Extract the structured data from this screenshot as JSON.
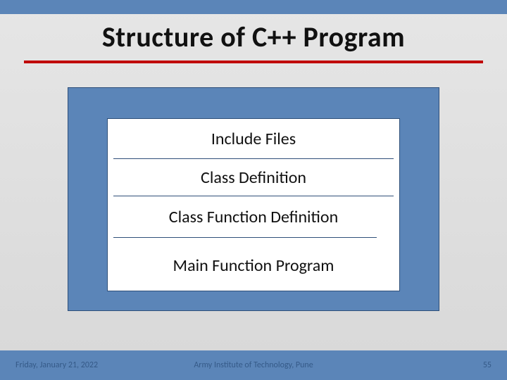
{
  "title": "Structure of C++ Program",
  "rows": {
    "r1": "Include Files",
    "r2": "Class Definition",
    "r3": "Class Function Definition",
    "r4": "Main Function Program"
  },
  "footer": {
    "date": "Friday, January 21, 2022",
    "org": "Army Institute of Technology, Pune",
    "page": "55"
  }
}
